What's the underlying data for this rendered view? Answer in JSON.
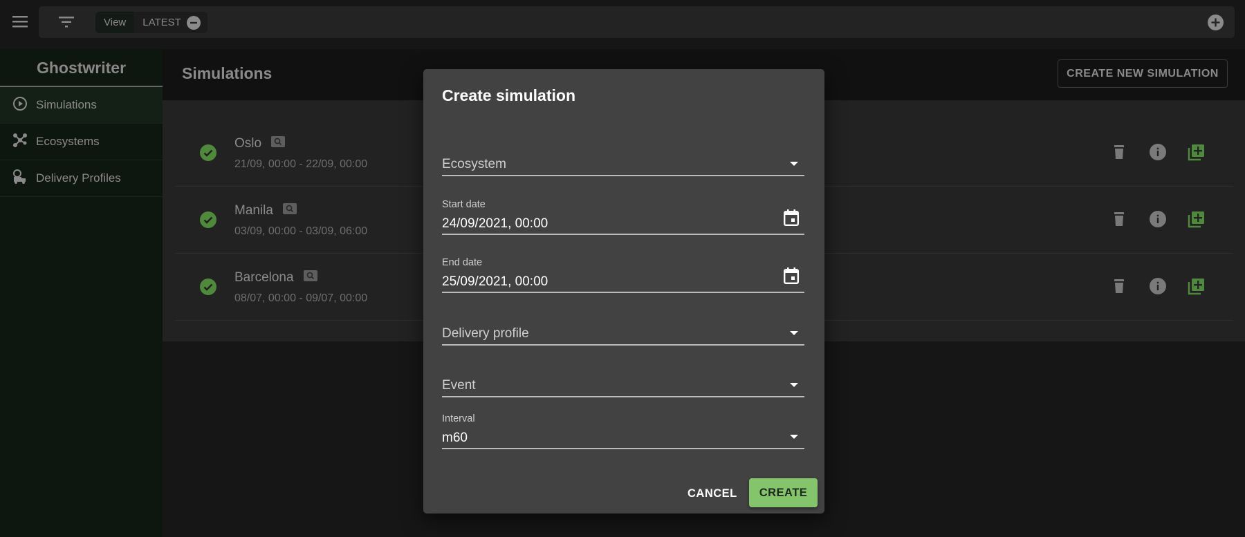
{
  "topbar": {
    "view_label": "View",
    "view_value": "LATEST"
  },
  "sidebar": {
    "title": "Ghostwriter",
    "items": [
      {
        "label": "Simulations",
        "icon": "play-circle-icon",
        "active": true
      },
      {
        "label": "Ecosystems",
        "icon": "network-icon"
      },
      {
        "label": "Delivery Profiles",
        "icon": "delivery-truck-icon"
      }
    ]
  },
  "header": {
    "title": "Simulations",
    "create_button": "CREATE NEW SIMULATION"
  },
  "simulations": [
    {
      "name": "Oslo",
      "dates": "21/09, 00:00 - 22/09, 00:00",
      "status": "success"
    },
    {
      "name": "Manila",
      "dates": "03/09, 00:00 - 03/09, 06:00",
      "status": "success"
    },
    {
      "name": "Barcelona",
      "dates": "08/07, 00:00 - 09/07, 00:00",
      "status": "success"
    }
  ],
  "dialog": {
    "title": "Create simulation",
    "ecosystem_placeholder": "Ecosystem",
    "start_label": "Start date",
    "start_value": "24/09/2021, 00:00",
    "end_label": "End date",
    "end_value": "25/09/2021, 00:00",
    "delivery_placeholder": "Delivery profile",
    "event_placeholder": "Event",
    "interval_label": "Interval",
    "interval_value": "m60",
    "cancel": "CANCEL",
    "create": "CREATE"
  },
  "colors": {
    "accent": "#84c56b",
    "status_success": "#4f8a3c",
    "dialog_bg": "#424242"
  }
}
